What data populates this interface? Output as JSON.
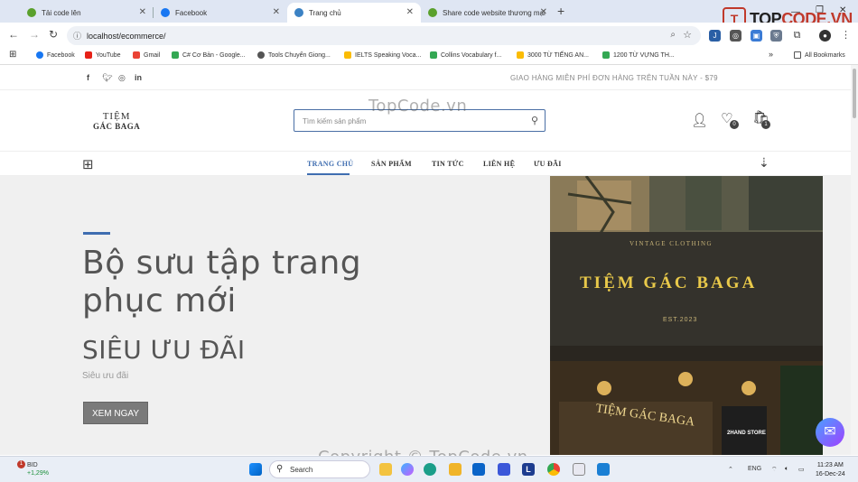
{
  "browser": {
    "tabs": [
      {
        "title": "Tải code lên",
        "icon_color": "#5aa02c"
      },
      {
        "title": "Facebook",
        "icon_color": "#1877f2"
      },
      {
        "title": "Trang chủ",
        "icon_color": "#3b82c4"
      },
      {
        "title": "Share code website thương mại",
        "icon_color": "#5aa02c"
      }
    ],
    "url": "localhost/ecommerce/",
    "bookmarks": [
      "Facebook",
      "YouTube",
      "Gmail",
      "C# Cơ Bản - Google...",
      "Tools Chuyển Giong...",
      "IELTS Speaking Voca...",
      "Collins Vocabulary f...",
      "3000 TỪ TIẾNG AN...",
      "1200 TỪ VỰNG TH...",
      "All Bookmarks"
    ]
  },
  "overlay_brand": {
    "prefix": "T",
    "name_a": "TOP",
    "name_b": "CODE.VN"
  },
  "watermarks": {
    "top": "TopCode.vn",
    "bottom": "Copyright © TopCode.vn"
  },
  "site": {
    "shipping_notice": "GIAO HÀNG MIỄN PHÍ ĐƠN HÀNG TRÊN TUẦN NÀY - $79",
    "logo_line1": "TIỆM",
    "logo_line2": "GÁC BAGA",
    "search_placeholder": "Tìm kiếm sản phẩm",
    "wishlist_count": "0",
    "cart_count": "1",
    "nav": [
      "TRANG CHỦ",
      "SẢN PHẨM",
      "TIN TỨC",
      "LIÊN HỆ",
      "ƯU ĐÃI"
    ],
    "hero": {
      "title": "Bộ sưu tập trang phục mới",
      "subtitle": "SIÊU ƯU ĐÃI",
      "small": "Siêu ưu đãi",
      "button": "XEM NGAY",
      "sign_top": "VINTAGE CLOTHING",
      "sign_main": "TIỆM GÁC BAGA",
      "sign_est": "EST.2023",
      "window_text": "TIỆM GÁC BAGA",
      "store_sign": "2HAND STORE"
    }
  },
  "taskbar": {
    "stock_name": "BID",
    "stock_change": "+1,29%",
    "stock_badge": "1",
    "search_label": "Search",
    "lang": "ENG",
    "time": "11:23 AM",
    "date": "16-Dec-24"
  }
}
